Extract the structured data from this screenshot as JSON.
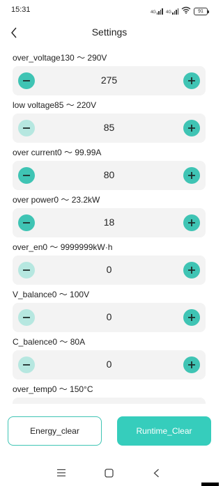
{
  "status_bar": {
    "time": "15:31",
    "network_1": "4G",
    "network_2": "4G",
    "battery": "91"
  },
  "header": {
    "title": "Settings",
    "back_icon": "chevron-left-icon"
  },
  "colors": {
    "accent": "#3fc4b4",
    "accent_disabled": "#b6e7e0",
    "stepper_bg": "#f3f3f3",
    "primary_button": "#36cdbc"
  },
  "settings": [
    {
      "label": "over_voltage130 ～ 290V",
      "value": "275",
      "minus_enabled": true,
      "plus_enabled": true
    },
    {
      "label": "low voltage85 ～ 220V",
      "value": "85",
      "minus_enabled": false,
      "plus_enabled": true
    },
    {
      "label": "over current0 ～ 99.99A",
      "value": "80",
      "minus_enabled": true,
      "plus_enabled": true
    },
    {
      "label": "over power0 ～ 23.2kW",
      "value": "18",
      "minus_enabled": true,
      "plus_enabled": true
    },
    {
      "label": "over_en0 ～ 9999999kW·h",
      "value": "0",
      "minus_enabled": false,
      "plus_enabled": true
    },
    {
      "label": "V_balance0 ～ 100V",
      "value": "0",
      "minus_enabled": false,
      "plus_enabled": true
    },
    {
      "label": "C_balence0 ～ 80A",
      "value": "0",
      "minus_enabled": false,
      "plus_enabled": true
    },
    {
      "label": "over_temp0 ～ 150°C",
      "value": "",
      "minus_enabled": true,
      "plus_enabled": true
    }
  ],
  "actions": {
    "energy_clear": "Energy_clear",
    "runtime_clear": "Runtime_Clear"
  },
  "nav": {
    "menu_icon": "menu-icon",
    "home_icon": "home-square-icon",
    "back_icon": "back-triangle-icon"
  }
}
